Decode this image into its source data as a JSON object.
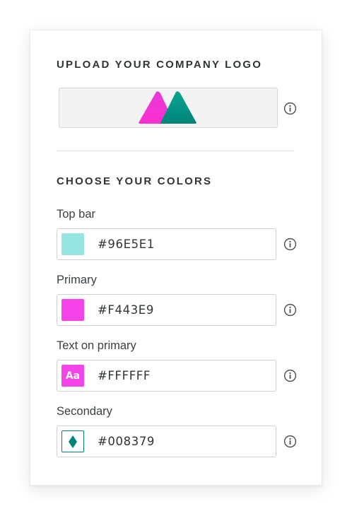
{
  "logo_section": {
    "title": "UPLOAD YOUR COMPANY LOGO",
    "logo_icon": "company-logo-twin-triangles",
    "logo_colors": [
      "#F443E9",
      "#008379"
    ],
    "info_icon": "info-icon"
  },
  "colors_section": {
    "title": "CHOOSE YOUR COLORS",
    "fields": [
      {
        "label": "Top bar",
        "value": "#96E5E1",
        "swatch_color": "#96E5E1",
        "swatch_text": ""
      },
      {
        "label": "Primary",
        "value": "#F443E9",
        "swatch_color": "#F443E9",
        "swatch_text": ""
      },
      {
        "label": "Text on primary",
        "value": "#FFFFFF",
        "swatch_color": "#F443E9",
        "swatch_text": "Aa"
      },
      {
        "label": "Secondary",
        "value": "#008379",
        "swatch_color": "#008379",
        "swatch_icon": "diamond-icon"
      }
    ]
  }
}
